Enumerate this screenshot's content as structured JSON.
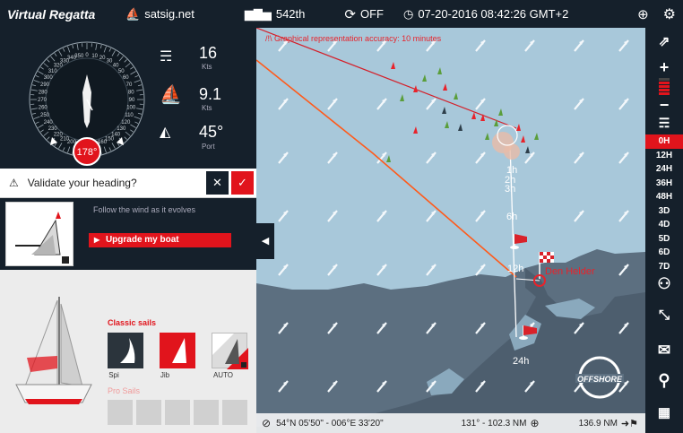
{
  "topbar": {
    "logo": "Virtual Regatta",
    "site": "satsig.net",
    "rank": "542th",
    "sync": "OFF",
    "datetime": "07-20-2016 08:42:26 GMT+2"
  },
  "instruments": {
    "wind_speed": "16",
    "wind_unit": "Kts",
    "boat_speed": "9.1",
    "boat_unit": "Kts",
    "twa": "45°",
    "tack": "Port",
    "heading": "178°",
    "compass_labels": [
      "0",
      "10",
      "20",
      "30",
      "40",
      "50",
      "60",
      "70",
      "80",
      "90",
      "100",
      "110",
      "120",
      "130",
      "140",
      "150",
      "160",
      "170",
      "190",
      "200",
      "210",
      "220",
      "230",
      "240",
      "250",
      "260",
      "270",
      "280",
      "290",
      "300",
      "310",
      "320",
      "330",
      "340",
      "350"
    ]
  },
  "validate": {
    "text": "Validate your heading?"
  },
  "boat_panel": {
    "tip": "Follow the wind as it evolves",
    "upgrade": "Upgrade my boat"
  },
  "sails": {
    "classic_title": "Classic sails",
    "items": [
      {
        "label": "Spi"
      },
      {
        "label": "Jib"
      },
      {
        "label": "AUTO"
      }
    ],
    "pro_title": "Pro Sails"
  },
  "map": {
    "accuracy_notice": "/!\\ Graphical representation accuracy: 10 minutes",
    "time_marks": [
      "1h",
      "2h",
      "3h",
      "6h",
      "12h",
      "24h"
    ],
    "place": "Den Helder",
    "offshore_logo": "OFFSHORE"
  },
  "rightbar": {
    "times": [
      "0H",
      "12H",
      "24H",
      "36H",
      "48H",
      "3D",
      "4D",
      "5D",
      "6D",
      "7D"
    ],
    "active": "0H"
  },
  "bottombar": {
    "position": "54°N 05'50\" - 006°E 33'20\"",
    "bearing": "131° - 102.3 NM",
    "distance": "136.9 NM"
  },
  "colors": {
    "accent": "#e1141c",
    "panel": "#15202b",
    "sea": "#a8c8da",
    "land": "#5c6f80"
  }
}
